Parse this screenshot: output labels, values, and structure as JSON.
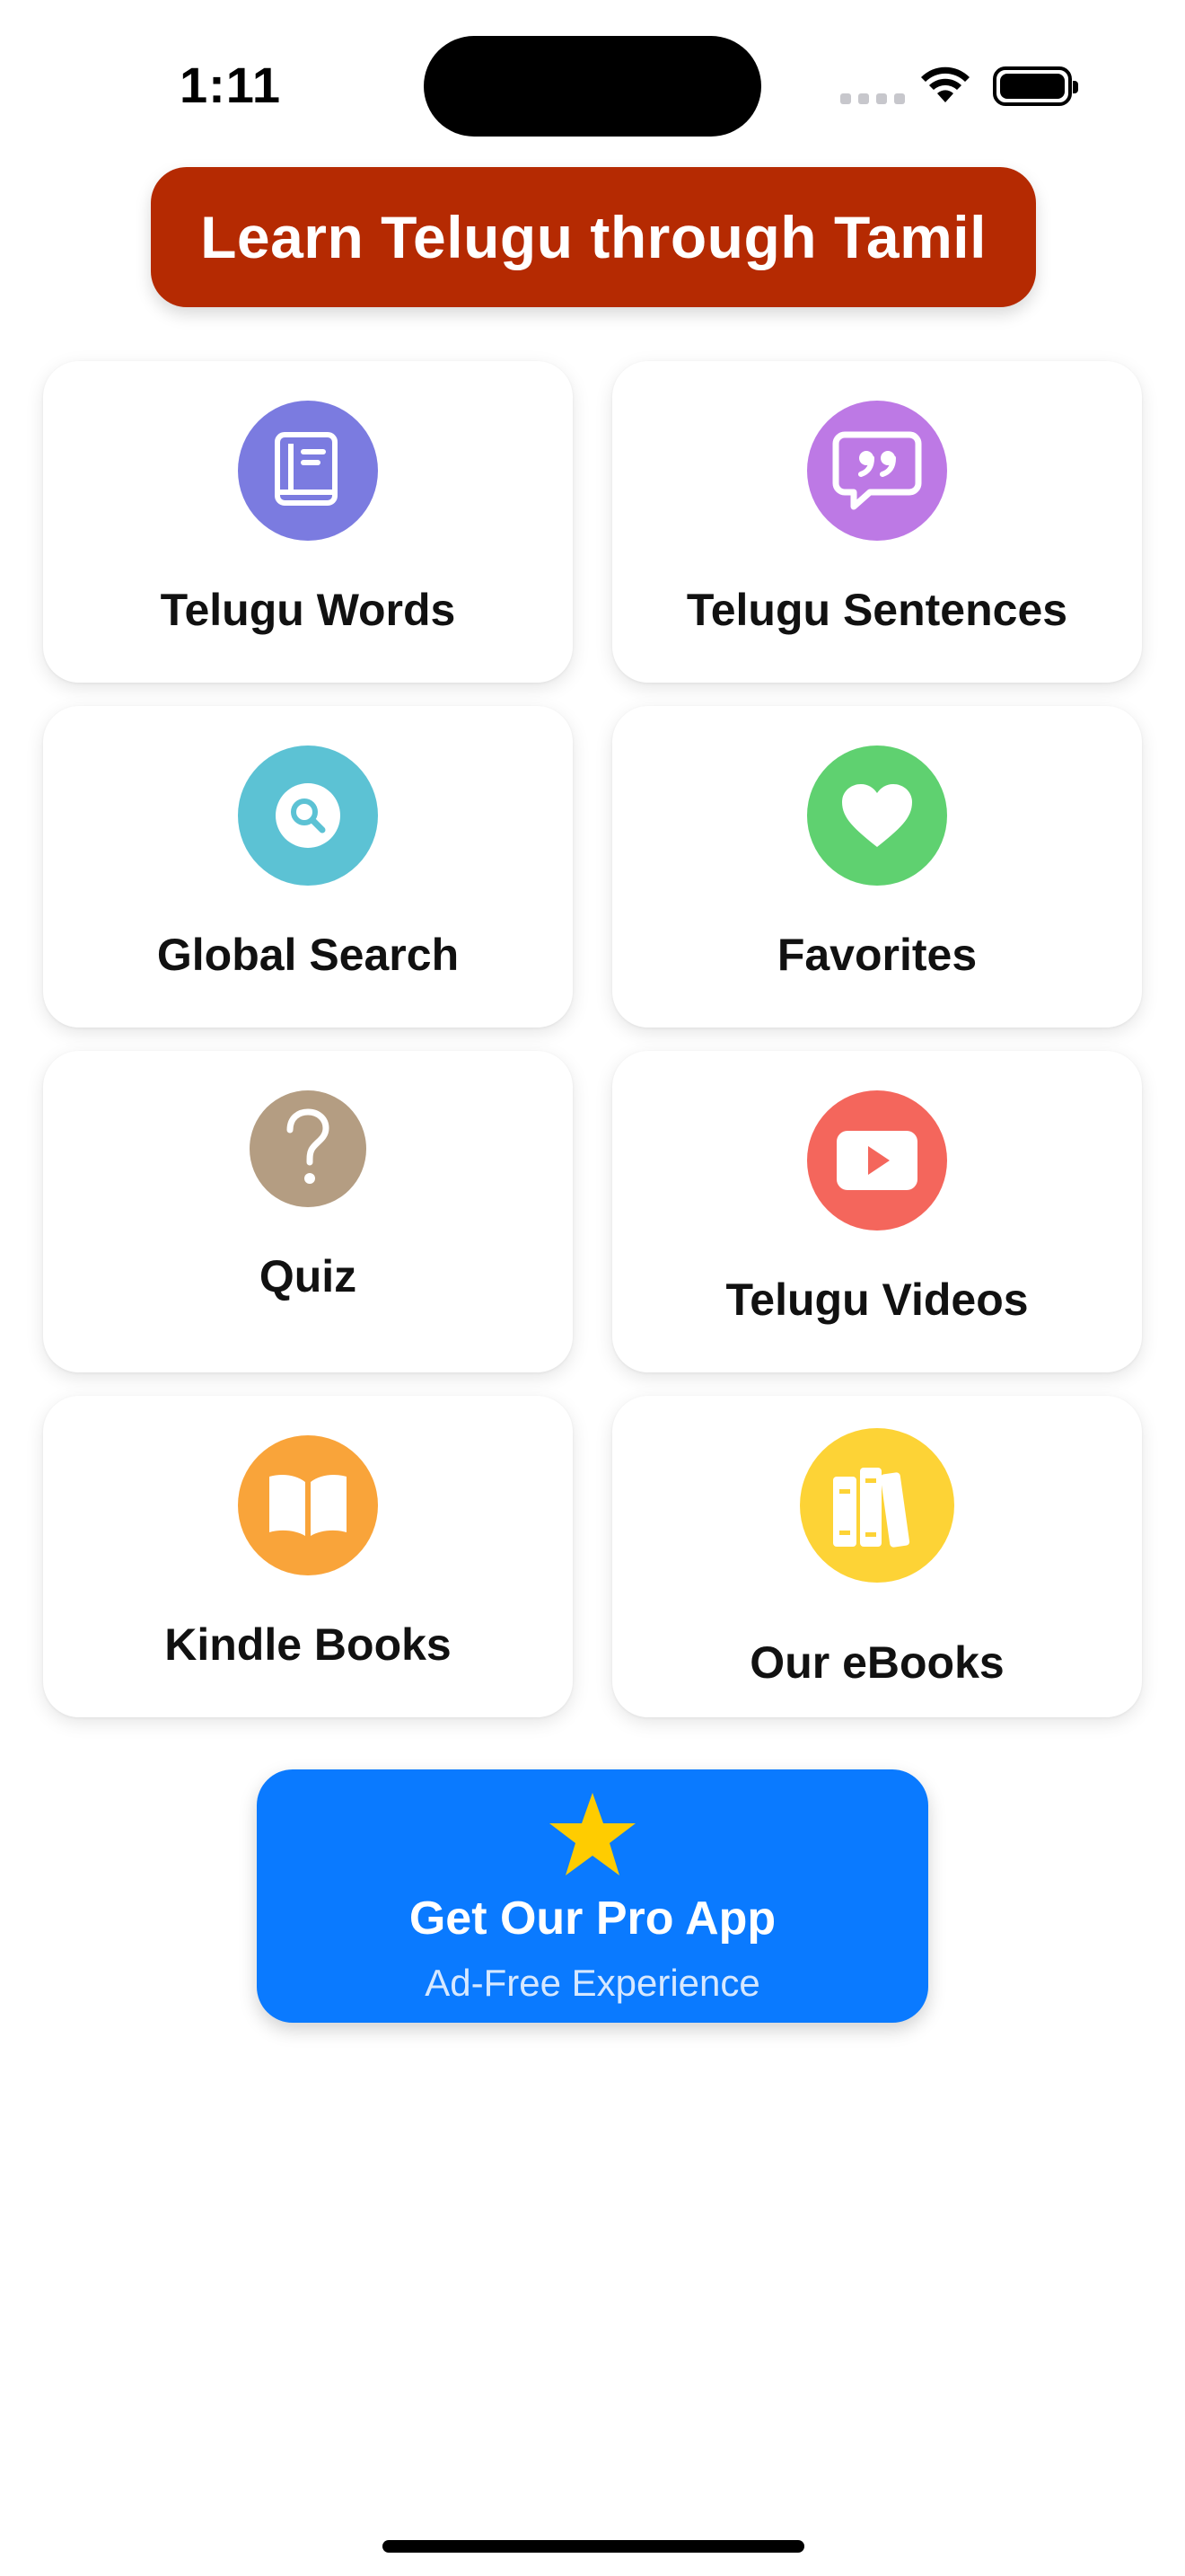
{
  "status_bar": {
    "time": "1:11"
  },
  "header": {
    "title": "Learn Telugu through Tamil"
  },
  "menu": {
    "items": [
      {
        "label": "Telugu Words",
        "icon": "book-icon",
        "color": "#7b7be0"
      },
      {
        "label": "Telugu Sentences",
        "icon": "quote-bubble-icon",
        "color": "#bd79e5"
      },
      {
        "label": "Global Search",
        "icon": "search-icon",
        "color": "#5cc2d4"
      },
      {
        "label": "Favorites",
        "icon": "heart-icon",
        "color": "#5fd170"
      },
      {
        "label": "Quiz",
        "icon": "question-icon",
        "color": "#b49d82"
      },
      {
        "label": "Telugu Videos",
        "icon": "play-icon",
        "color": "#f4665c"
      },
      {
        "label": "Kindle Books",
        "icon": "open-book-icon",
        "color": "#f9a43a"
      },
      {
        "label": "Our eBooks",
        "icon": "books-icon",
        "color": "#fdd336"
      }
    ]
  },
  "pro": {
    "title": "Get Our Pro App",
    "subtitle": "Ad-Free Experience",
    "accent": "#0a7aff",
    "star_color": "#ffcc00"
  }
}
